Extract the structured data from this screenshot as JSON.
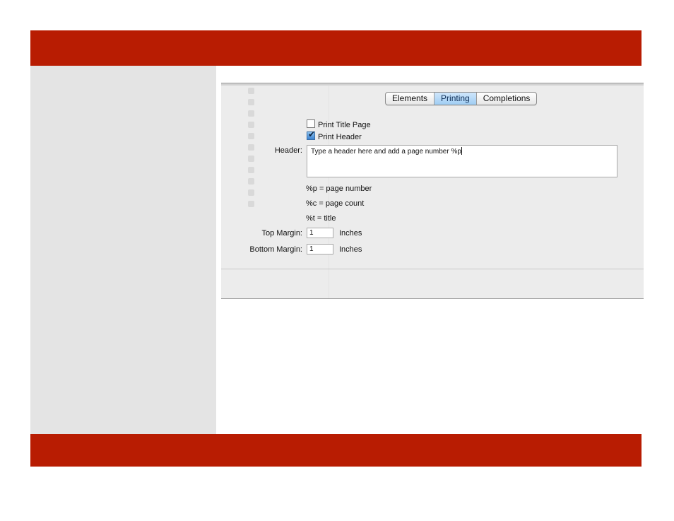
{
  "tabs": [
    {
      "label": "Elements",
      "active": false
    },
    {
      "label": "Printing",
      "active": true
    },
    {
      "label": "Completions",
      "active": false
    }
  ],
  "options": {
    "print_title_page": {
      "label": "Print Title Page",
      "checked": false
    },
    "print_header": {
      "label": "Print Header",
      "checked": true
    }
  },
  "header": {
    "label": "Header:",
    "value": "Type a header here and add a page number %p"
  },
  "legend": {
    "page_number": "%p = page number",
    "page_count": "%c = page count",
    "title": "%t = title"
  },
  "margins": {
    "top_label": "Top Margin:",
    "top_value": "1",
    "bottom_label": "Bottom Margin:",
    "bottom_value": "1",
    "unit": "Inches"
  },
  "colors": {
    "band_red": "#b81c02",
    "panel_gray": "#e4e4e4",
    "tab_active_blue": "#9fcdf3"
  }
}
